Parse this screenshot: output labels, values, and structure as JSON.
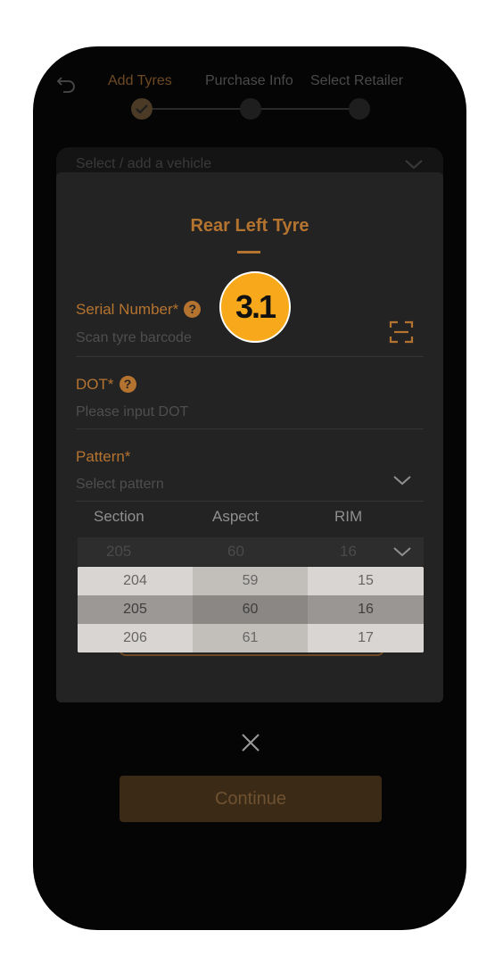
{
  "header": {
    "steps": [
      {
        "label": "Add Tyres",
        "state": "done"
      },
      {
        "label": "Purchase Info",
        "state": "pending"
      },
      {
        "label": "Select Retailer",
        "state": "pending"
      }
    ]
  },
  "vehicle": {
    "placeholder": "Select / add a vehicle"
  },
  "modal": {
    "title": "Rear Left Tyre",
    "serial": {
      "label": "Serial Number*",
      "placeholder": "Scan tyre barcode",
      "help": "?"
    },
    "badge": "3.1",
    "dot": {
      "label": "DOT*",
      "placeholder": "Please input DOT",
      "help": "?"
    },
    "pattern": {
      "label": "Pattern*",
      "placeholder": "Select pattern"
    },
    "size": {
      "headers": [
        "Section",
        "Aspect",
        "RIM"
      ],
      "selected": [
        "205",
        "60",
        "16"
      ]
    }
  },
  "picker": {
    "section": [
      "204",
      "205",
      "206"
    ],
    "aspect": [
      "59",
      "60",
      "61"
    ],
    "rim": [
      "15",
      "16",
      "17"
    ]
  },
  "footer": {
    "continue_label": "Continue"
  },
  "colors": {
    "accent": "#b57330",
    "badge": "#f7a91b"
  }
}
